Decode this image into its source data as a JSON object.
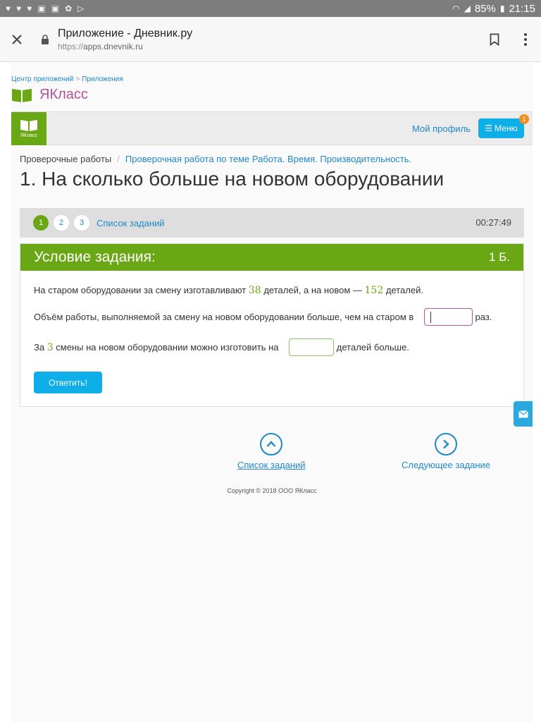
{
  "status_bar": {
    "battery": "85%",
    "time": "21:15"
  },
  "browser": {
    "page_title": "Приложение - Дневник.ру",
    "url_protocol": "https://",
    "url_host": "apps.dnevnik.ru"
  },
  "breadcrumb": {
    "items": [
      "Центр приложений",
      "Приложения"
    ],
    "separator": ">"
  },
  "brand": {
    "name": "ЯКласс",
    "color": "#b0559d"
  },
  "header": {
    "logo_label": "ЯКласс",
    "profile_link": "Мой профиль",
    "menu_label": "Меню",
    "menu_badge": "1"
  },
  "crumbs": {
    "parent": "Проверочные работы",
    "current": "Проверочная работа по теме Работа. Время. Производительность.",
    "separator": "/"
  },
  "task": {
    "title": "1. На сколько больше на новом оборудовании",
    "nav_numbers": [
      "1",
      "2",
      "3"
    ],
    "task_list_link": "Список заданий",
    "timer": "00:27:49",
    "condition_label": "Условие задания:",
    "points": "1 Б.",
    "line1": {
      "a": "На старом оборудовании за смену изготавливают",
      "n1": "38",
      "b": "деталей, а на новом —",
      "n2": "152",
      "c": "деталей."
    },
    "line2": {
      "a": "Объём работы, выполняемой за смену на новом оборудовании больше, чем на старом в",
      "b": "раз.",
      "input_value": ""
    },
    "line3": {
      "a": "За",
      "n": "3",
      "b": "смены на новом оборудовании можно изготовить на",
      "c": "деталей больше.",
      "input_value": ""
    },
    "answer_button": "Ответить!"
  },
  "bottom_nav": {
    "task_list": "Список заданий",
    "next_task": "Следующее задание"
  },
  "copyright": "Copyright © 2018 ООО ЯКласс",
  "colors": {
    "green": "#6aa715",
    "blue_link": "#1e88c9",
    "button_blue": "#0eaee8",
    "badge_orange": "#f08c20"
  }
}
